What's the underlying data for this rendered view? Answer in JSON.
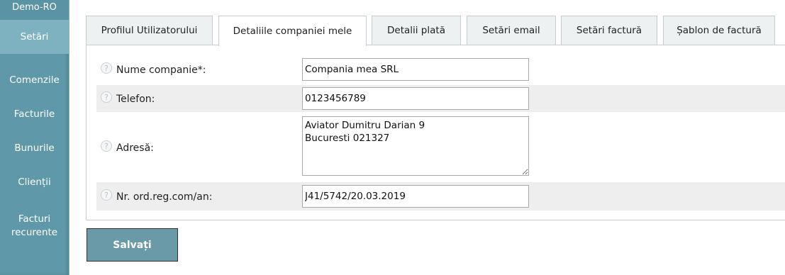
{
  "sidebar": {
    "app_name": "Demo-RO",
    "items": [
      {
        "label": "Setări",
        "active": true
      },
      {
        "label": "Comenzile"
      },
      {
        "label": "Facturile"
      },
      {
        "label": "Bunurile"
      },
      {
        "label": "Clienții"
      },
      {
        "label": "Facturi recurente"
      }
    ]
  },
  "tabs": [
    {
      "label": "Profilul Utilizatorului"
    },
    {
      "label": "Detaliile companiei mele",
      "active": true
    },
    {
      "label": "Detalii plată"
    },
    {
      "label": "Setări email"
    },
    {
      "label": "Setări factură"
    },
    {
      "label": "Șablon de factură"
    }
  ],
  "form": {
    "help_glyph": "?",
    "company_name": {
      "label": "Nume companie*:",
      "value": "Compania mea SRL"
    },
    "phone": {
      "label": "Telefon:",
      "value": "0123456789"
    },
    "address": {
      "label": "Adresă:",
      "value": "Aviator Dumitru Darian 9\nBucuresti 021327"
    },
    "reg_number": {
      "label": "Nr. ord.reg.com/an:",
      "value": "J41/5742/20.03.2019"
    }
  },
  "save_label": "Salvați",
  "colors": {
    "sidebar_bg": "#5f98a8",
    "sidebar_active": "#7fb2c0",
    "button_bg": "#6a9aa8",
    "row_bg": "#eeeeee"
  }
}
